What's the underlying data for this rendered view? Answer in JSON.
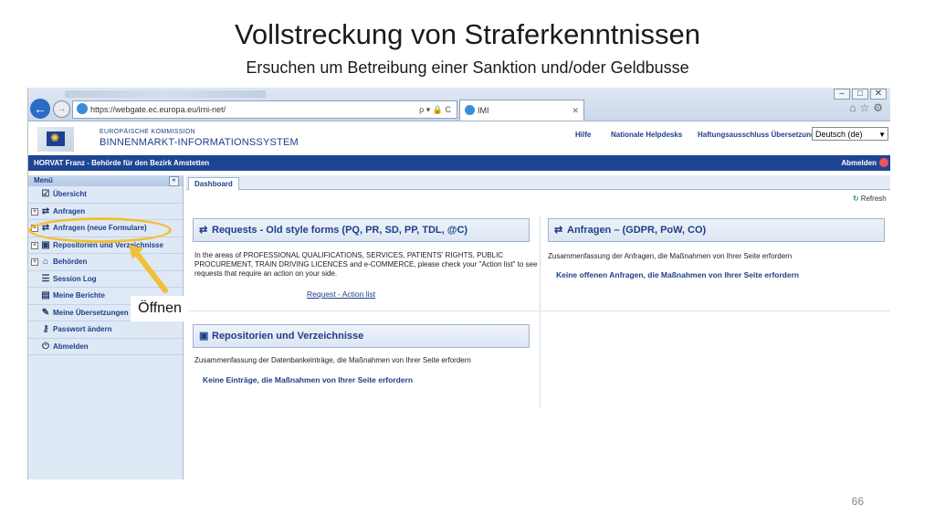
{
  "slide": {
    "title": "Vollstreckung von Straferkenntnissen",
    "subtitle": "Ersuchen um Betreibung einer Sanktion und/oder Geldbusse",
    "page_number": "66"
  },
  "browser": {
    "url": "https://webgate.ec.europa.eu/imi-net/",
    "tab_title": "IMI",
    "addr_tools": "ρ ▾ 🔒 C"
  },
  "header": {
    "commission": "EUROPÄISCHE KOMMISSION",
    "system": "BINNENMARKT-INFORMATIONSSYSTEM",
    "links": [
      "Hilfe",
      "Nationale Helpdesks",
      "Haftungsausschluss Übersetzung"
    ],
    "language": "Deutsch (de)"
  },
  "userbar": {
    "user": "HORVAT Franz - Behörde für den Bezirk Amstetten",
    "logout": "Abmelden"
  },
  "sidebar": {
    "header": "Menü",
    "collapse": "«",
    "items": [
      {
        "label": "Übersicht",
        "icon": "check-icon",
        "glyph": "☑",
        "expand": ""
      },
      {
        "label": "Anfragen",
        "icon": "exchange-icon",
        "glyph": "⇄",
        "expand": "+"
      },
      {
        "label": "Anfragen (neue Formulare)",
        "icon": "exchange-icon",
        "glyph": "⇄",
        "expand": "+"
      },
      {
        "label": "Repositorien und Verzeichnisse",
        "icon": "inbox-icon",
        "glyph": "▣",
        "expand": "+"
      },
      {
        "label": "Behörden",
        "icon": "building-icon",
        "glyph": "⌂",
        "expand": "+"
      },
      {
        "label": "Session Log",
        "icon": "list-icon",
        "glyph": "☰",
        "expand": ""
      },
      {
        "label": "Meine Berichte",
        "icon": "report-icon",
        "glyph": "▤",
        "expand": ""
      },
      {
        "label": "Meine Übersetzungen",
        "icon": "chat-icon",
        "glyph": "✎",
        "expand": ""
      },
      {
        "label": "Passwort ändern",
        "icon": "key-icon",
        "glyph": "⚷",
        "expand": ""
      },
      {
        "label": "Abmelden",
        "icon": "power-icon",
        "glyph": "⏻",
        "expand": ""
      }
    ]
  },
  "content": {
    "tab": "Dashboard",
    "refresh": "Refresh",
    "requests": {
      "title": "Requests - Old style forms (PQ, PR, SD, PP, TDL, @C)",
      "lines": [
        "In the areas of PROFESSIONAL QUALIFICATIONS, SERVICES, PATIENTS' RIGHTS, PUBLIC",
        "PROCUREMENT, TRAIN DRIVING LICENCES and e-COMMERCE, please check your \"Action list\" to see",
        "requests that require an action on your side."
      ],
      "link": "Request - Action list"
    },
    "anfragen": {
      "title": "Anfragen – (GDPR, PoW, CO)",
      "summary": "Zusammenfassung der Anfragen, die Maßnahmen von Ihrer Seite erfordern",
      "link": "Keine offenen Anfragen, die Maßnahmen von Ihrer Seite erfordern"
    },
    "repositorien": {
      "title": "Repositorien und Verzeichnisse",
      "summary": "Zusammenfassung der Datenbankeinträge, die Maßnahmen von Ihrer Seite erfordern",
      "link": "Keine Einträge, die Maßnahmen von Ihrer Seite erfordern"
    }
  },
  "annotation": {
    "callout": "Öffnen",
    "color": "#f2c037"
  },
  "colors": {
    "brand_blue": "#1e4593",
    "link_blue": "#1d3f88",
    "sidebar_bg": "#dfe9f6"
  }
}
